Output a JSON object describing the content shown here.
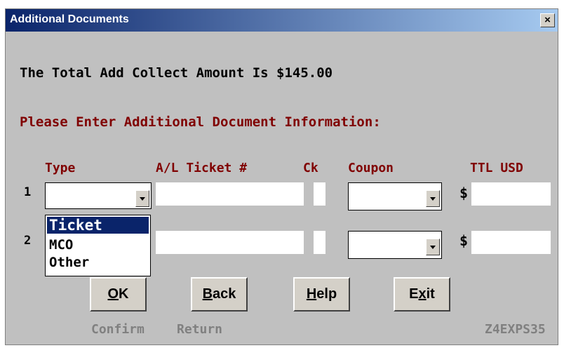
{
  "window": {
    "title": "Additional Documents",
    "close_glyph": "×"
  },
  "message": {
    "total_line": "The Total Add Collect Amount Is $145.00",
    "prompt": "Please Enter Additional Document Information:"
  },
  "columns": {
    "type": "Type",
    "ticket": "A/L Ticket #",
    "ck": "Ck",
    "coupon": "Coupon",
    "ttl": "TTL USD"
  },
  "rows": [
    {
      "number": "1",
      "currency": "$"
    },
    {
      "number": "2",
      "currency": "$"
    }
  ],
  "type_dropdown": {
    "options": [
      "Ticket",
      "MCO",
      "Other"
    ],
    "highlighted": "Ticket"
  },
  "buttons": {
    "ok": {
      "pre": "",
      "mnemonic": "O",
      "post": "K",
      "caption": "Confirm"
    },
    "back": {
      "pre": "",
      "mnemonic": "B",
      "post": "ack",
      "caption": "Return"
    },
    "help": {
      "pre": "",
      "mnemonic": "H",
      "post": "elp",
      "caption": ""
    },
    "exit": {
      "pre": "E",
      "mnemonic": "x",
      "post": "it",
      "caption": ""
    }
  },
  "screen_id": "Z4EXPS35"
}
